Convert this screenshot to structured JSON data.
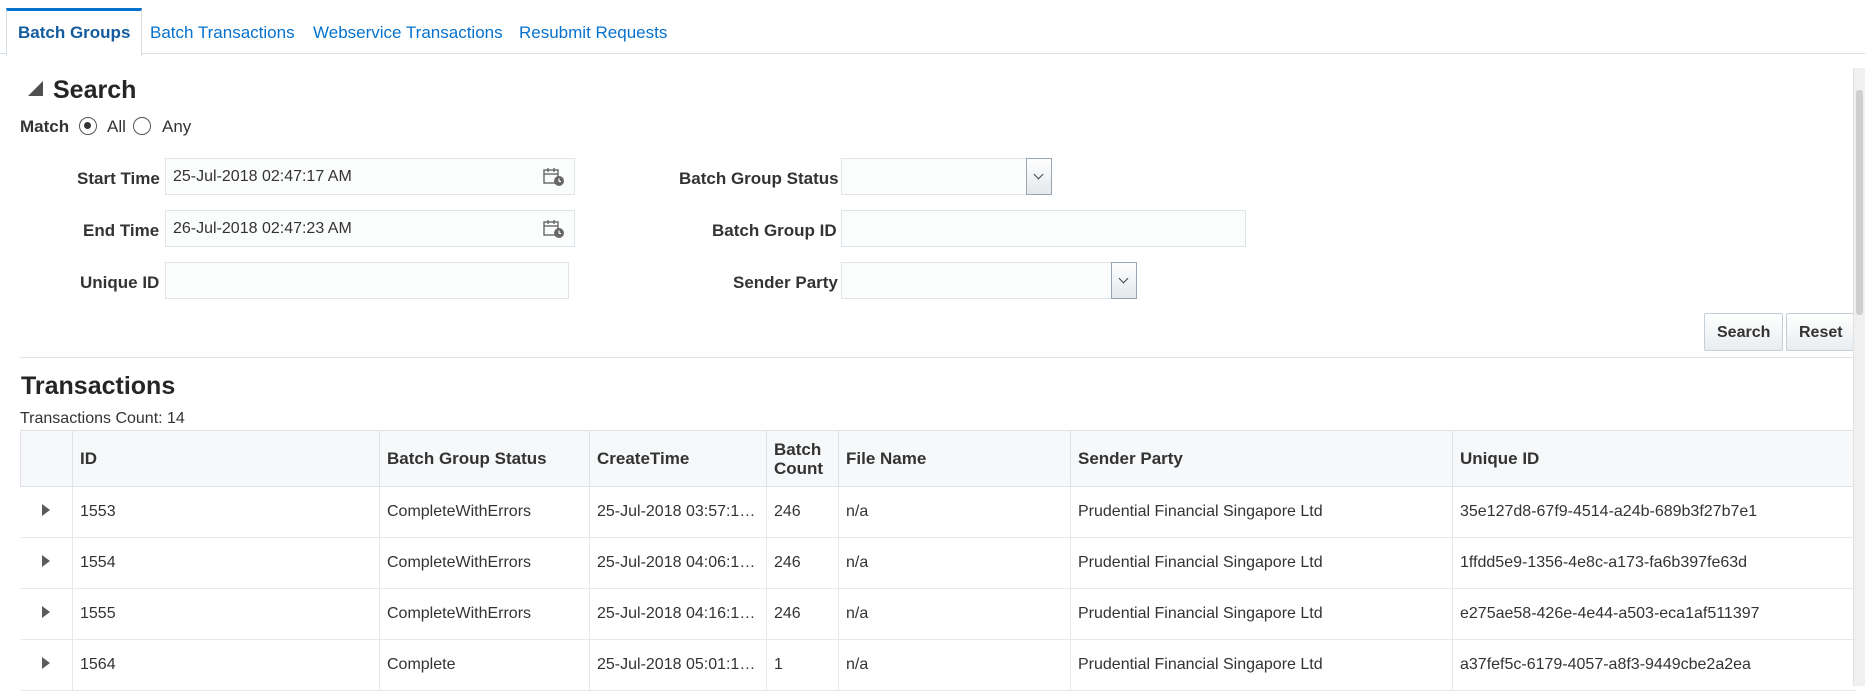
{
  "tabs": [
    "Batch Groups",
    "Batch Transactions",
    "Webservice Transactions",
    "Resubmit Requests"
  ],
  "search": {
    "title": "Search",
    "match_label": "Match",
    "match_all": "All",
    "match_any": "Any",
    "start_time_label": "Start Time",
    "start_time_value": "25-Jul-2018 02:47:17 AM",
    "end_time_label": "End Time",
    "end_time_value": "26-Jul-2018 02:47:23 AM",
    "unique_id_label": "Unique ID",
    "unique_id_value": "",
    "batch_group_status_label": "Batch Group Status",
    "batch_group_status_value": "",
    "batch_group_id_label": "Batch Group ID",
    "batch_group_id_value": "",
    "sender_party_label": "Sender Party",
    "sender_party_value": "",
    "search_button": "Search",
    "reset_button": "Reset"
  },
  "transactions": {
    "title": "Transactions",
    "count_text": "Transactions Count: 14",
    "columns": {
      "id": "ID",
      "status": "Batch Group Status",
      "create_time": "CreateTime",
      "batch_count": "Batch Count",
      "file_name": "File Name",
      "sender": "Sender Party",
      "unique_id": "Unique ID"
    },
    "rows": [
      {
        "id": "1553",
        "status": "CompleteWithErrors",
        "create_time": "25-Jul-2018 03:57:1…",
        "batch_count": "246",
        "file_name": "n/a",
        "sender": "Prudential Financial Singapore Ltd",
        "unique_id": "35e127d8-67f9-4514-a24b-689b3f27b7e1"
      },
      {
        "id": "1554",
        "status": "CompleteWithErrors",
        "create_time": "25-Jul-2018 04:06:1…",
        "batch_count": "246",
        "file_name": "n/a",
        "sender": "Prudential Financial Singapore Ltd",
        "unique_id": "1ffdd5e9-1356-4e8c-a173-fa6b397fe63d"
      },
      {
        "id": "1555",
        "status": "CompleteWithErrors",
        "create_time": "25-Jul-2018 04:16:1…",
        "batch_count": "246",
        "file_name": "n/a",
        "sender": "Prudential Financial Singapore Ltd",
        "unique_id": "e275ae58-426e-4e44-a503-eca1af511397"
      },
      {
        "id": "1564",
        "status": "Complete",
        "create_time": "25-Jul-2018 05:01:1…",
        "batch_count": "1",
        "file_name": "n/a",
        "sender": "Prudential Financial Singapore Ltd",
        "unique_id": "a37fef5c-6179-4057-a8f3-9449cbe2a2ea"
      }
    ]
  }
}
